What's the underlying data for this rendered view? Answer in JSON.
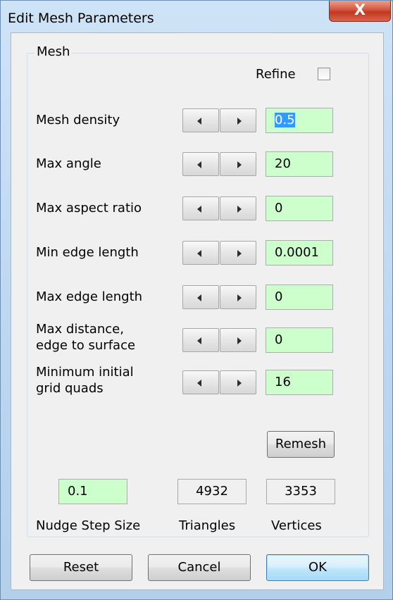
{
  "window": {
    "title": "Edit Mesh Parameters",
    "close_glyph": "X"
  },
  "mesh_group": {
    "label": "Mesh",
    "refine": {
      "label": "Refine",
      "checked": false
    },
    "params": [
      {
        "label": "Mesh density",
        "value": "0.5",
        "selected": true
      },
      {
        "label": "Max angle",
        "value": "20"
      },
      {
        "label": "Max aspect ratio",
        "value": "0"
      },
      {
        "label": "Min edge length",
        "value": "0.0001"
      },
      {
        "label": "Max edge length",
        "value": "0"
      },
      {
        "label_line1": "Max distance,",
        "label_line2": "edge to surface",
        "value": "0"
      },
      {
        "label_line1": "Minimum initial",
        "label_line2": "grid quads",
        "value": "16"
      }
    ],
    "remesh_label": "Remesh",
    "nudge": {
      "value": "0.1",
      "caption": "Nudge Step Size"
    },
    "triangles": {
      "value": "4932",
      "caption": "Triangles"
    },
    "vertices": {
      "value": "3353",
      "caption": "Vertices"
    }
  },
  "footer": {
    "reset_label": "Reset",
    "cancel_label": "Cancel",
    "ok_label": "OK"
  },
  "icons": {
    "spin_left": "triangle-left-icon",
    "spin_right": "triangle-right-icon",
    "close": "close-icon"
  }
}
